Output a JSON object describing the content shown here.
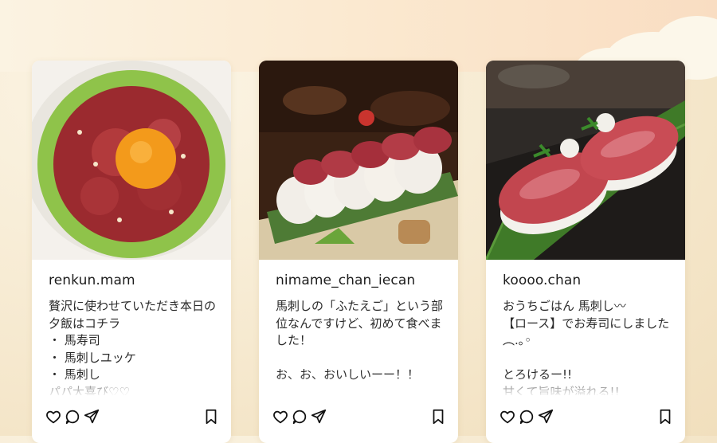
{
  "posts": [
    {
      "username": "renkun.mam",
      "caption": "贅沢に使わせていただき本日の夕飯はコチラ\n・ 馬寿司\n・ 馬刺しユッケ\n・ 馬刺し\nパパ大喜び♡♡",
      "image_desc": "horse-meat-yukhoe-with-egg-yolk"
    },
    {
      "username": "nimame_chan_iecan",
      "caption": "馬刺しの「ふたえご」という部位なんですけど、初めて食べました！\n\nお、お、おいしいーー！！",
      "image_desc": "horse-sashimi-futaego"
    },
    {
      "username": "koooo.chan",
      "caption": "おうちごはん 馬刺し〰\n【ロース】でお寿司にしました ︵.｡◦\n\nとろけるー!!\n甘くて旨味が溢れる!!",
      "image_desc": "horse-meat-nigiri-sushi"
    }
  ],
  "icons": {
    "like": "heart-icon",
    "comment": "comment-icon",
    "share": "send-icon",
    "save": "bookmark-icon"
  }
}
